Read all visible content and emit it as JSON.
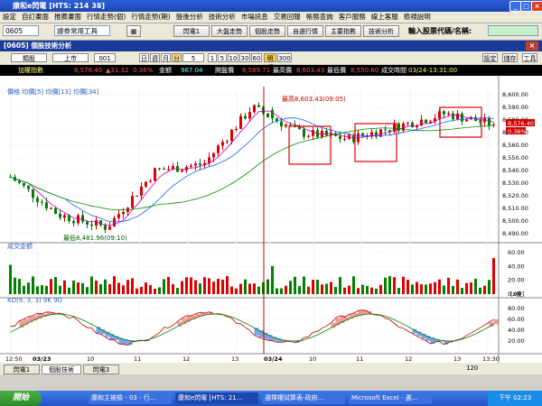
{
  "window": {
    "title": "康和e閃電 [HTS: 214 38]"
  },
  "menu": [
    "設定",
    "自訂畫面",
    "推薦畫面",
    "行情走勢(個)",
    "行情走勢(期)",
    "盤後分析",
    "技術分析",
    "市場訊息",
    "交易回報",
    "帳務查詢",
    "客戶服務",
    "線上客服",
    "檢視說明"
  ],
  "toolbar": {
    "code": "0605",
    "tool_select": "證券常用工具",
    "buttons": [
      "閃電1",
      "大盤走勢",
      "個股走勢",
      "自選行情",
      "主要指數",
      "技術分析"
    ],
    "search_label": "輸入股票代碼/名稱:"
  },
  "panel": {
    "title": "[0605] 個股技術分析",
    "right_buttons": [
      "設定",
      "儲存",
      "工具"
    ]
  },
  "controls": {
    "category": "類股",
    "market": "上市",
    "code": "001",
    "periods": [
      "日",
      "週",
      "月",
      "分"
    ],
    "interval": "5",
    "intervals": [
      "1",
      "5",
      "10",
      "30",
      "60"
    ],
    "tag_vol": "明細",
    "tag_300": "300"
  },
  "info": {
    "name": "加權指數",
    "price": "8,576.40",
    "change": "▲31.32",
    "pct": "0.36%",
    "amt_label": "金額",
    "amount": "967.04",
    "high_label": "最高價",
    "open_label": "開盤價",
    "open": "8,589.71",
    "high": "8,603.43",
    "low_label": "最低價",
    "low": "8,550.60",
    "time_label": "成交時間",
    "time": "03/24-13:31:00"
  },
  "chart": {
    "legend_price": "價格 均價[5] 均價[13] 均價[34]",
    "legend_vol": "成交金額",
    "legend_kd": "KD(9, 3, 3) 9K 9D",
    "high_annot": "最高8,603.43(09:05)",
    "low_annot": "最低8,481.96(09:10)",
    "price_ticks": [
      "8,600.00",
      "8,590.00",
      "8,580.00",
      "8,570.00",
      "8,560.00",
      "8,550.00",
      "8,540.00",
      "8,530.00",
      "8,520.00",
      "8,510.00",
      "8,500.00",
      "8,490.00"
    ],
    "vol_ticks": [
      "60.00",
      "40.00",
      "20.00",
      "0.00"
    ],
    "vol_unit": "[x億]",
    "kd_ticks": [
      "80.00",
      "60.00",
      "40.00",
      "20.00"
    ],
    "time_ticks": [
      "12:50",
      "03/23",
      "10",
      "11",
      "12",
      "13",
      "03/24",
      "10",
      "11",
      "12",
      "13",
      "13:30"
    ],
    "price_tag": "8,576.40",
    "pct_tag": "0.36%",
    "zoom": "120"
  },
  "chart_data": {
    "type": "candlestick",
    "x": [
      "03/23 09:00",
      "03/23 10:00",
      "03/23 11:00",
      "03/23 12:00",
      "03/23 13:00",
      "03/24 09:00",
      "03/24 10:00",
      "03/24 11:00",
      "03/24 12:00",
      "03/24 13:00",
      "03/24 13:30"
    ],
    "close": [
      8535,
      8505,
      8495,
      8540,
      8545,
      8590,
      8570,
      8565,
      8575,
      8585,
      8576.4
    ],
    "ylim": [
      8485,
      8605
    ]
  },
  "tabs": [
    "閃電1",
    "個股技術",
    "閃電3"
  ],
  "taskbar": {
    "start": "開始",
    "items": [
      "康和主被檢 - 03 - 行...",
      "康和e閃電 [HTS: 21...",
      "選擇權試算表-政府...",
      "Microsoft Excel - 選..."
    ],
    "clock": "下午 02:23"
  }
}
